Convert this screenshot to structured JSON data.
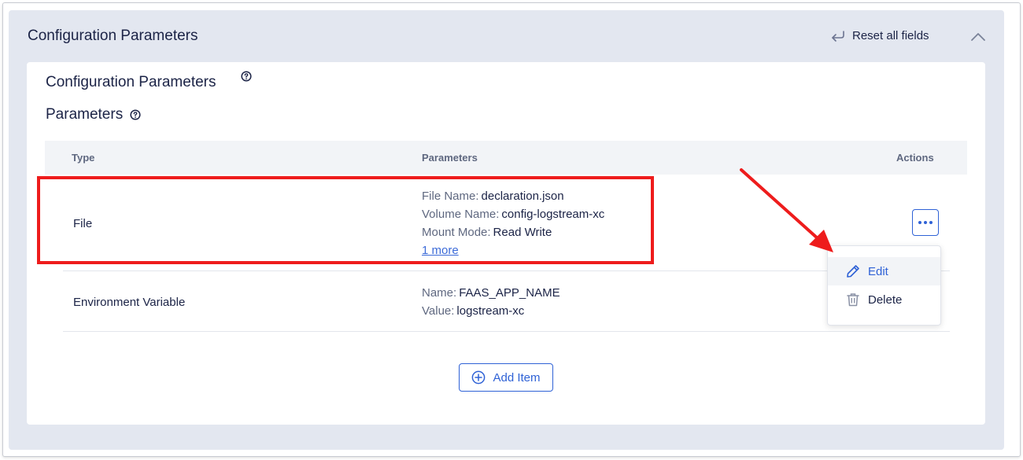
{
  "panel": {
    "title": "Configuration Parameters",
    "reset_label": "Reset all fields"
  },
  "section": {
    "title": "Configuration Parameters",
    "params_title": "Parameters"
  },
  "table": {
    "columns": [
      "Type",
      "Parameters",
      "Actions"
    ],
    "rows": [
      {
        "type": "File",
        "params": [
          {
            "key": "File Name:",
            "value": "declaration.json"
          },
          {
            "key": "Volume Name:",
            "value": "config-logstream-xc"
          },
          {
            "key": "Mount Mode:",
            "value": "Read Write"
          }
        ],
        "more_link": "1 more"
      },
      {
        "type": "Environment Variable",
        "params": [
          {
            "key": "Name:",
            "value": "FAAS_APP_NAME"
          },
          {
            "key": "Value:",
            "value": "logstream-xc"
          }
        ]
      }
    ]
  },
  "menu": {
    "edit_label": "Edit",
    "delete_label": "Delete"
  },
  "add_item_label": "Add Item",
  "colors": {
    "accent": "#2f62d6",
    "highlight": "#ee1c1c",
    "panel_bg": "#e3e7f0",
    "header_bg": "#f2f4f7"
  },
  "icons": [
    "reset-icon",
    "chevron-up-icon",
    "help-icon",
    "more-icon",
    "pencil-icon",
    "trash-icon",
    "plus-circle-icon",
    "arrow-annotation"
  ]
}
